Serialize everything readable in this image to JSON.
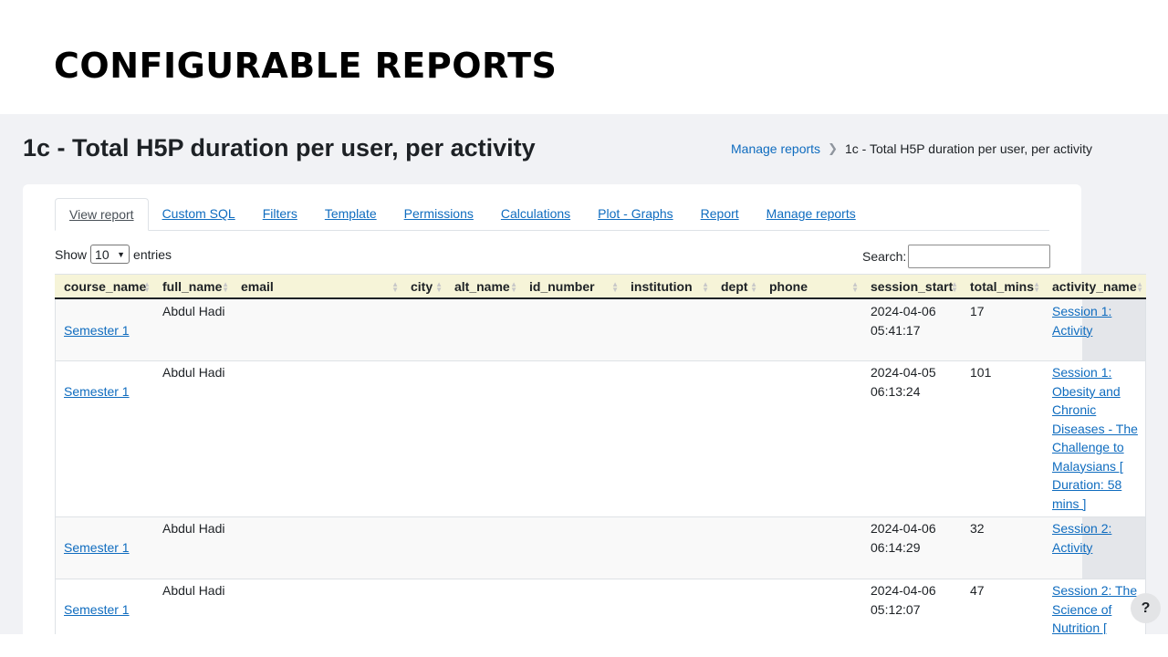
{
  "slide": {
    "title": "CONFIGURABLE REPORTS"
  },
  "page": {
    "title": "1c - Total H5P duration per user, per activity"
  },
  "breadcrumb": {
    "items": [
      "Manage reports",
      "1c - Total H5P duration per user, per activity"
    ]
  },
  "tabs": [
    "View report",
    "Custom SQL",
    "Filters",
    "Template",
    "Permissions",
    "Calculations",
    "Plot - Graphs",
    "Report",
    "Manage reports"
  ],
  "table_controls": {
    "show_label": "Show",
    "entries_value": "10",
    "entries_label": "entries",
    "search_label": "Search:"
  },
  "columns": [
    "course_name",
    "full_name",
    "email",
    "city",
    "alt_name",
    "id_number",
    "institution",
    "dept",
    "phone",
    "session_start",
    "total_mins",
    "activity_name"
  ],
  "rows": [
    {
      "course_name": "Semester 1",
      "full_name": "Abdul Hadi",
      "session_start": [
        "2024-04-06",
        "05:41:17"
      ],
      "total_mins": "17",
      "activity_lines": [
        "Session 1:",
        "Activity"
      ]
    },
    {
      "course_name": "Semester 1",
      "full_name": "Abdul Hadi",
      "session_start": [
        "2024-04-05",
        "06:13:24"
      ],
      "total_mins": "101",
      "activity_lines": [
        "Session 1:",
        "Obesity and",
        "Chronic",
        "Diseases - The",
        "Challenge to",
        "Malaysians [",
        "Duration: 58",
        "mins ]"
      ]
    },
    {
      "course_name": "Semester 1",
      "full_name": "Abdul Hadi",
      "session_start": [
        "2024-04-06",
        "06:14:29"
      ],
      "total_mins": "32",
      "activity_lines": [
        "Session 2:",
        "Activity"
      ]
    },
    {
      "course_name": "Semester 1",
      "full_name": "Abdul Hadi",
      "session_start": [
        "2024-04-06",
        "05:12:07"
      ],
      "total_mins": "47",
      "activity_lines": [
        "Session 2: The",
        "Science of",
        "Nutrition ["
      ]
    }
  ],
  "help": {
    "label": "?"
  },
  "colors": {
    "link": "#0f6cbf",
    "header_bg": "#f6f4d8",
    "page_bg": "#f1f2f5"
  }
}
